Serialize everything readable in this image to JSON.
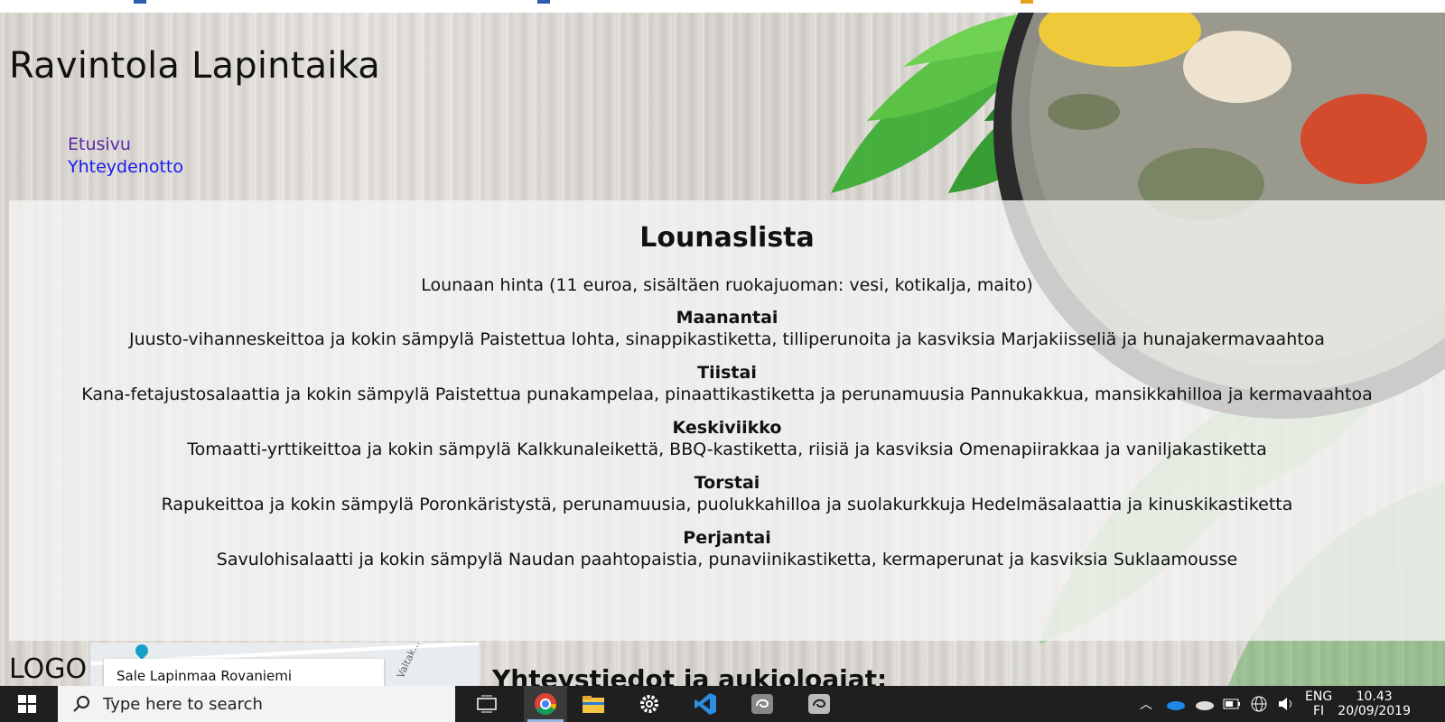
{
  "site": {
    "title": "Ravintola Lapintaika",
    "nav": [
      {
        "label": "Etusivu",
        "visited": true
      },
      {
        "label": "Yhteydenotto",
        "visited": false
      }
    ]
  },
  "lunch": {
    "heading": "Lounaslista",
    "price": "Lounaan hinta (11 euroa, sisältäen ruokajuoman: vesi, kotikalja, maito)",
    "days": [
      {
        "name": "Maanantai",
        "menu": "Juusto-vihanneskeittoa ja kokin sämpylä Paistettua lohta, sinappikastiketta, tilliperunoita ja kasviksia Marjakiisseliä ja hunajakermavaahtoa"
      },
      {
        "name": "Tiistai",
        "menu": "Kana-fetajustosalaattia ja kokin sämpylä Paistettua punakampelaa, pinaattikastiketta ja perunamuusia Pannukakkua, mansikkahilloa ja kermavaahtoa"
      },
      {
        "name": "Keskiviikko",
        "menu": "Tomaatti-yrttikeittoa ja kokin sämpylä Kalkkunaleikettä, BBQ-kastiketta, riisiä ja kasviksia Omenapiirakkaa ja vaniljakastiketta"
      },
      {
        "name": "Torstai",
        "menu": "Rapukeittoa ja kokin sämpylä Poronkäristystä, perunamuusia, puolukkahilloa ja suolakurkkuja Hedelmäsalaattia ja kinuskikastiketta"
      },
      {
        "name": "Perjantai",
        "menu": "Savulohisalaatti ja kokin sämpylä Naudan paahtopaistia, punaviinikastiketta, kermaperunat ja kasviksia Suklaamousse"
      }
    ]
  },
  "footer": {
    "logo": "LOGO",
    "map_place": "Sale Lapinmaa Rovaniemi",
    "map_street": "Valtak...",
    "contact_heading": "Yhteystiedot ja aukioloajat:"
  },
  "taskbar": {
    "search_placeholder": "Type here to search",
    "apps": [
      "task-view",
      "chrome",
      "file-explorer",
      "settings",
      "vscode",
      "app-1",
      "app-2"
    ],
    "language": "ENG",
    "language_sub": "FI",
    "time": "10.43",
    "date": "20/09/2019"
  },
  "colors": {
    "visited_link": "#5b2aa6",
    "link": "#1a1aee",
    "taskbar": "#1f1f1f"
  }
}
